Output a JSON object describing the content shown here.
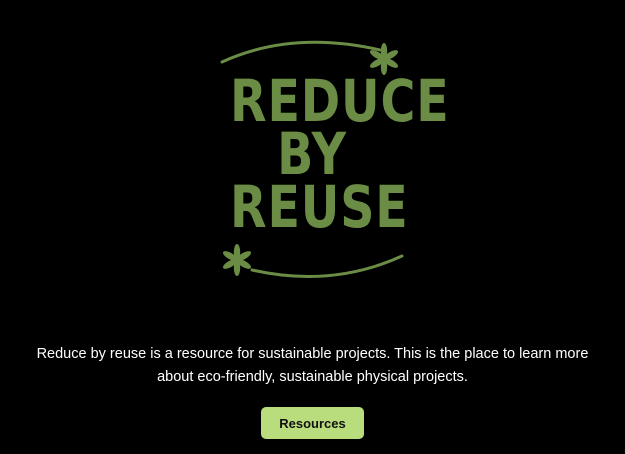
{
  "logo": {
    "lines": [
      "REDUCE",
      "BY",
      "REUSE"
    ],
    "color": "#6b8c45",
    "top_flower_icon": "asterisk-flower-icon",
    "bottom_flower_icon": "asterisk-flower-icon"
  },
  "intro": {
    "description": "Reduce by reuse is a resource for sustainable projects. This is the place to learn more about eco-friendly, sustainable physical projects."
  },
  "cta": {
    "resources_label": "Resources",
    "button_color": "#b9dc7d"
  }
}
